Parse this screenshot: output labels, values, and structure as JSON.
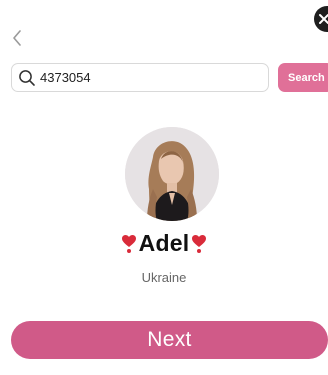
{
  "header": {
    "back_icon": "chevron-left-icon",
    "close_icon": "close-icon"
  },
  "search": {
    "value": "4373054",
    "placeholder": "",
    "button_label": "Search",
    "icon": "search-icon"
  },
  "profile": {
    "name": "Adel",
    "country": "Ukraine",
    "decoration_icon": "heart-exclamation-icon"
  },
  "actions": {
    "next_label": "Next"
  },
  "colors": {
    "accent": "#d05a88",
    "search_button": "#e07098",
    "heart": "#d92b3a"
  }
}
